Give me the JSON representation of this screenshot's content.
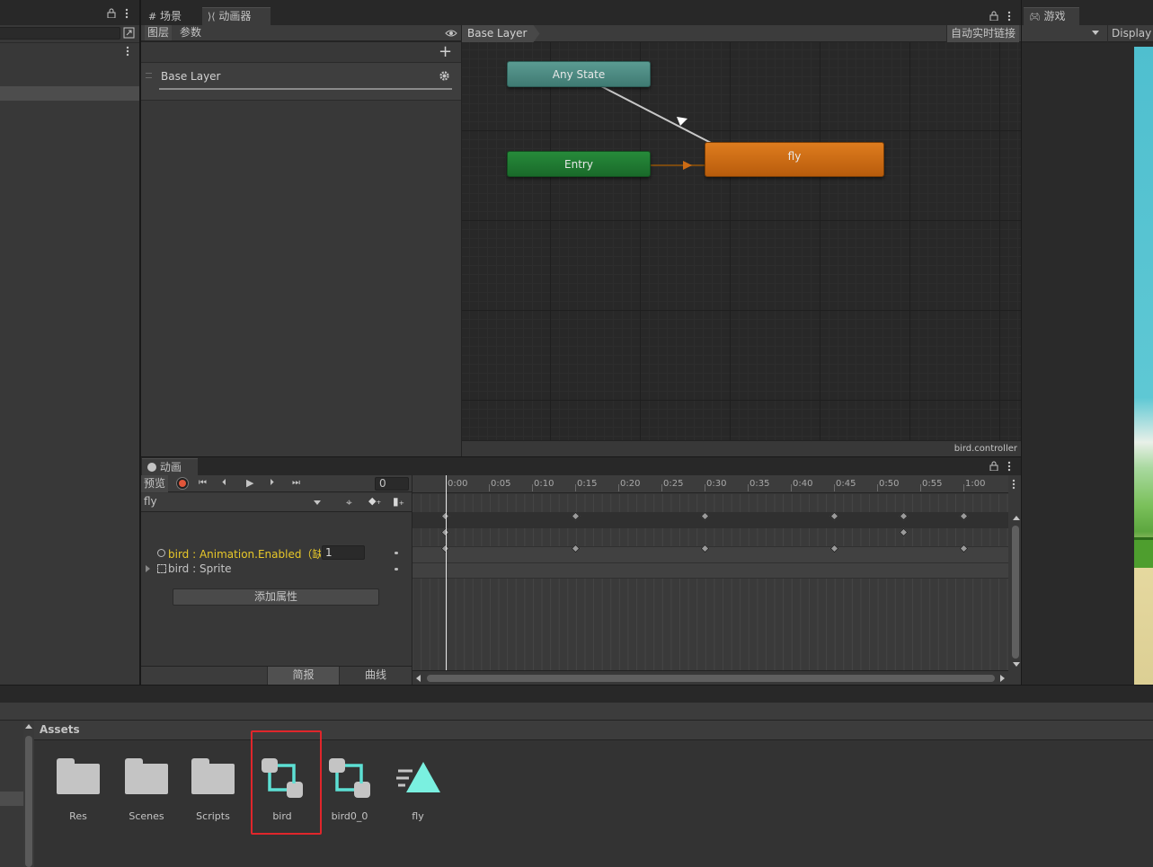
{
  "top_tabs": {
    "scene": "场景",
    "animator": "动画器",
    "game": "游戏"
  },
  "animator": {
    "sub_tabs": {
      "layers": "图层",
      "parameters": "参数"
    },
    "breadcrumb": "Base Layer",
    "auto_live_link": "自动实时链接",
    "layer_name": "Base Layer",
    "footer_file": "bird.controller",
    "nodes": {
      "any_state": "Any State",
      "entry": "Entry",
      "fly": "fly"
    }
  },
  "game": {
    "display": "Display"
  },
  "animation": {
    "tab_title": "动画",
    "preview": "预览",
    "frame_value": "0",
    "clip_name": "fly",
    "properties": [
      {
        "label": "bird : Animation.Enabled（缺",
        "value": "1"
      },
      {
        "label": "bird : Sprite",
        "value": ""
      }
    ],
    "add_property": "添加属性",
    "mode_dopesheet": "简报",
    "mode_curves": "曲线",
    "ruler": [
      "0:00",
      "0:05",
      "0:10",
      "0:15",
      "0:20",
      "0:25",
      "0:30",
      "0:35",
      "0:40",
      "0:45",
      "0:50",
      "0:55",
      "1:00"
    ]
  },
  "project": {
    "breadcrumb": "Assets",
    "items": [
      {
        "name": "Res",
        "type": "folder"
      },
      {
        "name": "Scenes",
        "type": "folder"
      },
      {
        "name": "Scripts",
        "type": "folder"
      },
      {
        "name": "bird",
        "type": "animator-controller",
        "highlighted": true
      },
      {
        "name": "bird0_0",
        "type": "animator-controller"
      },
      {
        "name": "fly",
        "type": "animation-clip"
      }
    ]
  },
  "colors": {
    "any_state": "#4f8c84",
    "entry": "#217a33",
    "fly_state": "#cc6b14",
    "highlight_box": "#e0262b",
    "record": "#e0563a",
    "property_text": "#e8c829"
  }
}
